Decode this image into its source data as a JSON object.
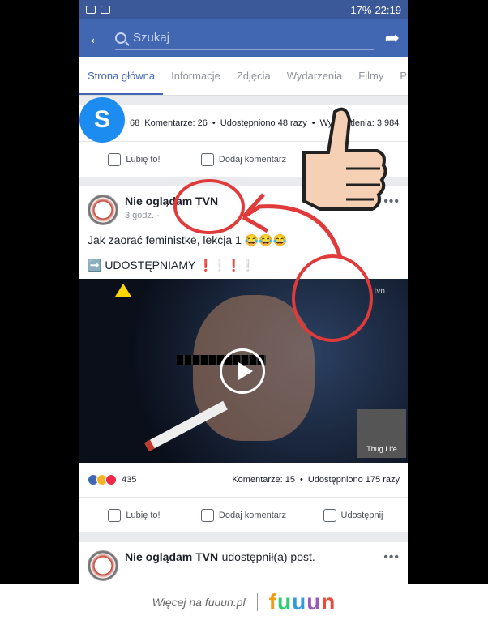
{
  "status_bar": {
    "battery": "17%",
    "time": "22:19"
  },
  "search": {
    "placeholder": "Szukaj"
  },
  "tabs": [
    {
      "label": "Strona główna"
    },
    {
      "label": "Informacje"
    },
    {
      "label": "Zdjęcia"
    },
    {
      "label": "Wydarzenia"
    },
    {
      "label": "Filmy"
    },
    {
      "label": "P"
    }
  ],
  "post1": {
    "reactions": "68",
    "comments": "Komentarze: 26",
    "shares": "Udostępniono 48 razy",
    "views": "Wyświetlenia: 3 984",
    "like_label": "Lubię to!",
    "comment_label": "Dodaj komentarz"
  },
  "post2": {
    "page_name": "Nie oglądam TVN",
    "time": "3 godz. ·",
    "text": "Jak zaorać feministke, lekcja 1 😂😂😂",
    "share_line": "➡️ UDOSTĘPNIAMY ❗❕❗❕",
    "video_logo": "tvn",
    "watermark": "Thug Life",
    "reactions": "435",
    "comments": "Komentarze: 15",
    "shares": "Udostępniono 175 razy",
    "like_label": "Lubię to!",
    "comment_label": "Dodaj komentarz",
    "share_label": "Udostępnij"
  },
  "post3": {
    "page_name": "Nie oglądam TVN",
    "suffix": "udostępnił(a) post."
  },
  "footer": {
    "text": "Więcej na fuuun.pl",
    "logo": [
      "f",
      "u",
      "u",
      "u",
      "n"
    ]
  },
  "colors": {
    "facebook_blue": "#4267b2",
    "annotation_red": "#e03a3a"
  }
}
